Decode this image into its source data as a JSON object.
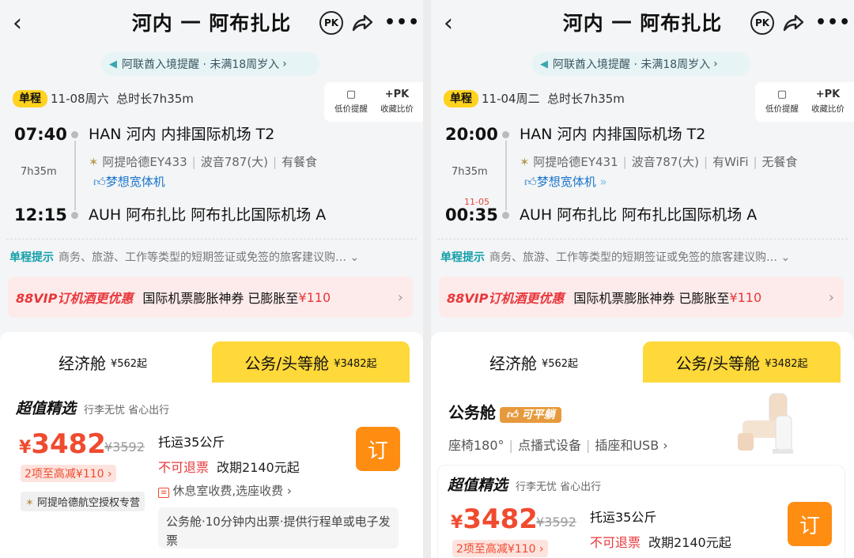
{
  "left": {
    "title": "河内 一 阿布扎比",
    "pk_label": "PK",
    "notice": "阿联酋入境提醒 · 未满18周岁入",
    "trip_type": "单程",
    "date": "11-08周六",
    "duration_total": "总时长7h35m",
    "price_alert": "低价提醒",
    "collect_compare": "收藏比价",
    "pk_plus": "+PK",
    "dep_time": "07:40",
    "arr_time": "12:15",
    "dep_airport": "HAN  河内  内排国际机场  T2",
    "arr_airport": "AUH  阿布扎比  阿布扎比国际机场  A",
    "duration": "7h35m",
    "airline": "阿提哈德EY433",
    "aircraft": "波音787(大)",
    "meal": "有餐食",
    "wide_body": "梦想宽体机",
    "tip_label": "单程提示",
    "tip_text": "商务、旅游、工作等类型的短期签证或免签的旅客建议购…",
    "promo_brand": "88VIP订机酒更优惠",
    "promo_text": "国际机票膨胀神券  已膨胀至",
    "promo_amount": "¥110",
    "tab_economy": "经济舱",
    "tab_economy_price": "¥562起",
    "tab_business": "公务/头等舱",
    "tab_business_price": "¥3482起",
    "offer_badge": "超值精选",
    "offer_sub": "行李无忧  省心出行",
    "currency": "¥",
    "price": "3482",
    "orig_price": "¥3592",
    "reduce": "2项至高减¥110 ›",
    "baggage": "托运35公斤",
    "no_refund": "不可退票",
    "change_fee": "改期2140元起",
    "order": "订",
    "auth": "阿提哈德航空授权专营",
    "fees": "休息室收费,选座收费  ›",
    "note": "公务舱·10分钟内出票·提供行程单或电子发票"
  },
  "right": {
    "title": "河内 一 阿布扎比",
    "pk_label": "PK",
    "notice": "阿联酋入境提醒 · 未满18周岁入",
    "trip_type": "单程",
    "date": "11-04周二",
    "duration_total": "总时长7h35m",
    "price_alert": "低价提醒",
    "collect_compare": "收藏比价",
    "pk_plus": "+PK",
    "dep_time": "20:00",
    "arr_time": "00:35",
    "arr_date": "11-05",
    "dep_airport": "HAN  河内  内排国际机场  T2",
    "arr_airport": "AUH  阿布扎比  阿布扎比国际机场  A",
    "duration": "7h35m",
    "airline": "阿提哈德EY431",
    "aircraft": "波音787(大)",
    "wifi": "有WiFi",
    "meal": "无餐食",
    "wide_body": "梦想宽体机",
    "tip_label": "单程提示",
    "tip_text": "商务、旅游、工作等类型的短期签证或免签的旅客建议购…",
    "promo_brand": "88VIP订机酒更优惠",
    "promo_text": "国际机票膨胀神券  已膨胀至",
    "promo_amount": "¥110",
    "tab_economy": "经济舱",
    "tab_economy_price": "¥562起",
    "tab_business": "公务/头等舱",
    "tab_business_price": "¥3482起",
    "cabin_title": "公务舱",
    "cabin_flat": "可平躺",
    "features": [
      "座椅180°",
      "点播式设备",
      "插座和USB"
    ],
    "offer_badge": "超值精选",
    "offer_sub": "行李无忧  省心出行",
    "currency": "¥",
    "price": "3482",
    "orig_price": "¥3592",
    "reduce": "2项至高减¥110 ›",
    "baggage": "托运35公斤",
    "no_refund": "不可退票",
    "change_fee": "改期2140元起",
    "order": "订"
  },
  "colors": {
    "accent_yellow": "#ffd83a",
    "price_red": "#f04a2f",
    "order_orange": "#ff8d12",
    "teal": "#139fa8"
  }
}
